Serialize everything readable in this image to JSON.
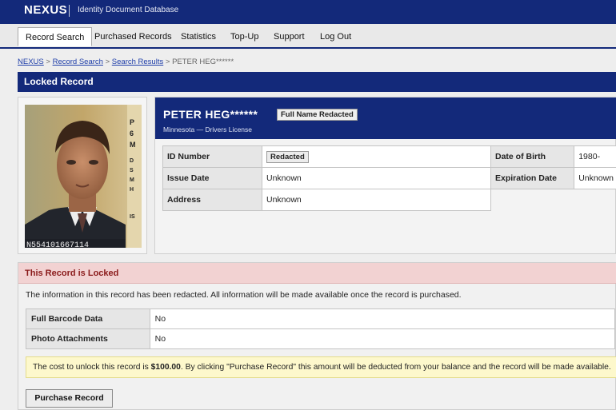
{
  "header": {
    "logo": "NEXUS",
    "subtitle": "Identity Document Database"
  },
  "nav": {
    "items": [
      {
        "label": "Record Search",
        "active": true
      },
      {
        "label": "Purchased Records"
      },
      {
        "label": "Statistics"
      },
      {
        "label": "Top-Up"
      },
      {
        "label": "Support"
      },
      {
        "label": "Log Out"
      }
    ]
  },
  "breadcrumb": {
    "items": [
      "NEXUS",
      "Record Search",
      "Search Results"
    ],
    "current": "PETER HEG******",
    "separator": ">"
  },
  "page_title": "Locked Record",
  "record": {
    "name": "PETER HEG******",
    "name_badge": "Full Name Redacted",
    "state_line": "Minnesota — Drivers License",
    "fields": {
      "id_label": "ID Number",
      "id_value": "Redacted",
      "dob_label": "Date of Birth",
      "dob_value": "1980-",
      "issue_label": "Issue Date",
      "issue_value": "Unknown",
      "exp_label": "Expiration Date",
      "exp_value": "Unknown",
      "address_label": "Address",
      "address_value": "Unknown"
    },
    "photo": {
      "edge_text": "N554101667114",
      "side_letters": [
        "P",
        "6",
        "M",
        "D",
        "S",
        "M",
        "H",
        "IS"
      ]
    }
  },
  "locked": {
    "heading": "This Record is Locked",
    "message": "The information in this record has been redacted. All information will be made available once the record is purchased.",
    "rows": [
      {
        "label": "Full Barcode Data",
        "value": "No"
      },
      {
        "label": "Photo Attachments",
        "value": "No"
      }
    ],
    "cost_pre": "The cost to unlock this record is ",
    "cost_amount": "$100.00",
    "cost_post": ". By clicking \"Purchase Record\" this amount will be deducted from your balance and the record will be made available.",
    "button_label": "Purchase Record"
  },
  "colors": {
    "header_bg": "#13297a",
    "locked_head_bg": "#f2d2d2",
    "locked_head_text": "#8a1a1a",
    "note_bg": "#fdf8cc"
  }
}
